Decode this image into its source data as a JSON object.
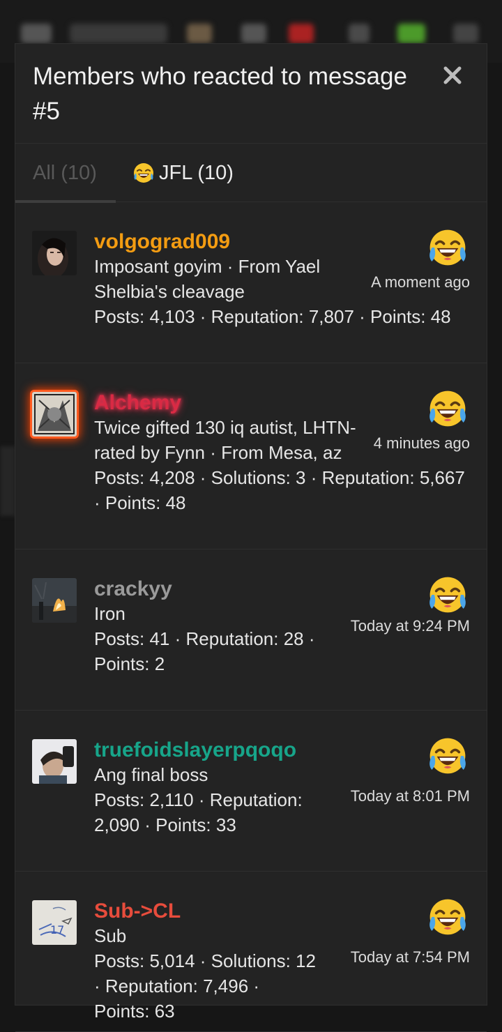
{
  "dialog": {
    "title": "Members who reacted to message #5",
    "close_label": "✕"
  },
  "tabs": [
    {
      "label": "All (10)"
    },
    {
      "label": "JFL (10)"
    }
  ],
  "members": [
    {
      "username": "volgograd009",
      "username_color": "#f39c12",
      "title": "Imposant goyim · From Yael Shelbia's cleavage",
      "stats": "Posts: 4,103 · Reputation: 7,807 · Points: 48",
      "time": "A moment ago",
      "avatar": "portrait-dark"
    },
    {
      "username": "Alchemy",
      "username_color": "#e2344a",
      "title": "Twice gifted 130 iq autist, LHTN-rated by Fynn · From Mesa, az",
      "stats": "Posts: 4,208 · Solutions: 3 · Reputation: 5,667 · Points: 48",
      "time": "4 minutes ago",
      "avatar": "engraving"
    },
    {
      "username": "crackyy",
      "username_color": "#9a9a9a",
      "title": "Iron",
      "stats": "Posts: 41 · Reputation: 28 · Points: 2",
      "time": "Today at 9:24 PM",
      "avatar": "fire"
    },
    {
      "username": "truefoidslayerpqoqo",
      "username_color": "#17a58a",
      "title": "Ang final boss",
      "stats": "Posts: 2,110 · Reputation: 2,090 · Points: 33",
      "time": "Today at 8:01 PM",
      "avatar": "selfie"
    },
    {
      "username": "Sub->CL",
      "username_color": "#e74c3c",
      "title": "Sub",
      "stats": "Posts: 5,014 · Solutions: 12 · Reputation: 7,496 · Points: 63",
      "time": "Today at 7:54 PM",
      "avatar": "sketch"
    }
  ],
  "reaction": {
    "name": "JFL",
    "icon": "laughing-crying-emoji"
  }
}
